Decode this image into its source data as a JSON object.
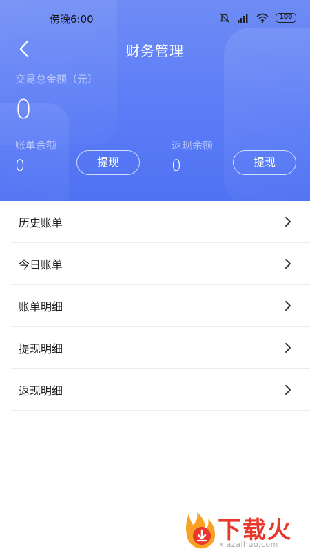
{
  "status_bar": {
    "time": "傍晚6:00",
    "battery": "100",
    "icons": [
      "mute-icon",
      "signal-icon",
      "wifi-icon",
      "battery-icon"
    ]
  },
  "header": {
    "title": "财务管理",
    "back_icon": "chevron-left-icon"
  },
  "summary": {
    "total_label": "交易总金额（元）",
    "total_value": "0",
    "bill_balance_label": "账单余额",
    "bill_balance_value": "0",
    "cashback_balance_label": "返现余额",
    "cashback_balance_value": "0",
    "withdraw_label": "提现"
  },
  "menu": {
    "items": [
      {
        "label": "历史账单"
      },
      {
        "label": "今日账单"
      },
      {
        "label": "账单明细"
      },
      {
        "label": "提现明细"
      },
      {
        "label": "返现明细"
      }
    ]
  },
  "watermark": {
    "brand_text": "下载火",
    "sub_text": "xiazaihuo.com"
  },
  "colors": {
    "header_gradient_top": "#6f8cf5",
    "header_gradient_bottom": "#4f72f3",
    "brand_red": "#e8372b"
  }
}
